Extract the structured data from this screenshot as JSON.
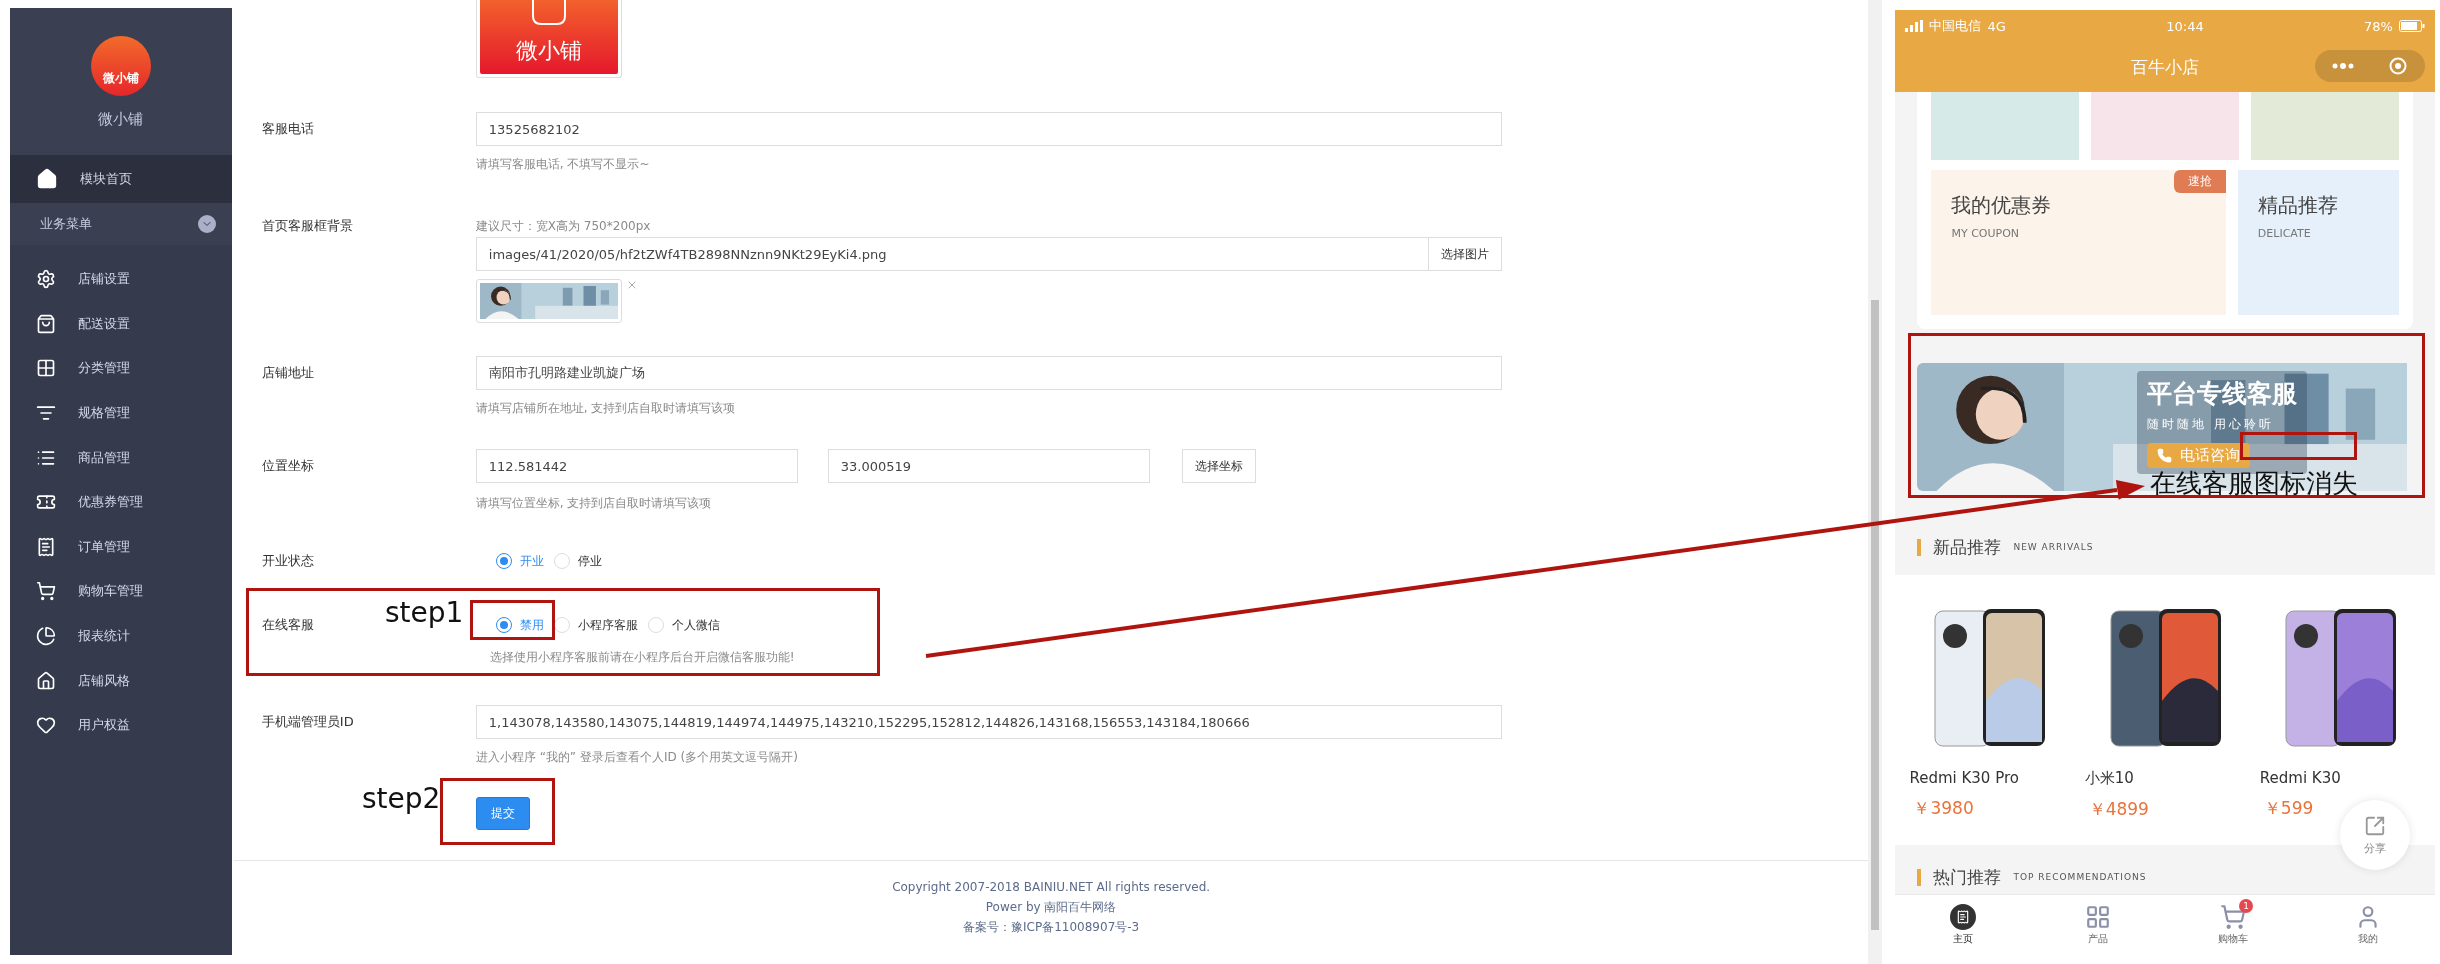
{
  "sidebar": {
    "logo_text": "微小铺",
    "brand": "微小铺",
    "home": {
      "label": "模块首页",
      "selected": true
    },
    "group": {
      "label": "业务菜单",
      "expanded": true
    },
    "items": [
      {
        "label": "店铺设置"
      },
      {
        "label": "配送设置"
      },
      {
        "label": "分类管理"
      },
      {
        "label": "规格管理"
      },
      {
        "label": "商品管理"
      },
      {
        "label": "优惠券管理"
      },
      {
        "label": "订单管理"
      },
      {
        "label": "购物车管理"
      },
      {
        "label": "报表统计"
      },
      {
        "label": "店铺风格"
      },
      {
        "label": "用户权益"
      }
    ]
  },
  "form": {
    "rows": [
      {
        "kind": "logo_image",
        "text": "微小铺"
      },
      {
        "kind": "input",
        "label": "客服电话",
        "value": "13525682102",
        "hint": "请填写客服电话, 不填写不显示~"
      },
      {
        "kind": "image_picker",
        "label": "首页客服框背景",
        "note": "建议尺寸：宽X高为 750*200px",
        "value": "images/41/2020/05/hf2tZWf4TB2898NNznn9NKt29EyKi4.png",
        "button": "选择图片"
      },
      {
        "kind": "input",
        "label": "店铺地址",
        "value": "南阳市孔明路建业凯旋广场",
        "hint": "请填写店铺所在地址, 支持到店自取时请填写该项"
      },
      {
        "kind": "coords",
        "label": "位置坐标",
        "values": [
          "112.581442",
          "33.000519"
        ],
        "button": "选择坐标",
        "hint": "请填写位置坐标, 支持到店自取时请填写该项"
      },
      {
        "kind": "radio",
        "label": "开业状态",
        "options": [
          {
            "label": "开业",
            "selected": true
          },
          {
            "label": "停业",
            "selected": false
          }
        ]
      },
      {
        "kind": "radio",
        "label": "在线客服",
        "options": [
          {
            "label": "禁用",
            "selected": true
          },
          {
            "label": "小程序客服",
            "selected": false
          },
          {
            "label": "个人微信",
            "selected": false
          }
        ],
        "hint": "选择使用小程序客服前请在小程序后台开启微信客服功能!"
      },
      {
        "kind": "input",
        "label": "手机端管理员ID",
        "value": "1,143078,143580,143075,144819,144974,144975,143210,152295,152812,144826,143168,156553,143184,180666",
        "hint": "进入小程序 “我的” 登录后查看个人ID (多个用英文逗号隔开)"
      }
    ],
    "submit": "提交"
  },
  "footer": [
    "Copyright 2007-2018 BAINIU.NET All rights reserved.",
    "Power by 南阳百牛网络",
    "备案号：豫ICP备11008907号-3"
  ],
  "annotations": [
    {
      "text": "step1"
    },
    {
      "text": "step2"
    },
    {
      "text": "在线客服图标消失"
    }
  ],
  "phone": {
    "status": {
      "carrier": "中国电信",
      "network": "4G",
      "time": "10:44",
      "battery": "78%"
    },
    "title": "百牛小店",
    "coupon": {
      "title": "我的优惠券",
      "subtitle": "MY COUPON",
      "badge": "速抢"
    },
    "featured": {
      "title": "精品推荐",
      "subtitle": "DELICATE"
    },
    "banner": {
      "title": "平台专线客服",
      "subtitle": "随时随地 用心聆听",
      "button": "电话咨询"
    },
    "new_arrivals": {
      "title": "新品推荐",
      "subtitle": "NEW ARRIVALS",
      "products": [
        {
          "name": "Redmi K30 Pro",
          "price": "￥3980"
        },
        {
          "name": "小米10",
          "price": "￥4899"
        },
        {
          "name": "Redmi K30",
          "price": "￥599"
        }
      ]
    },
    "share": "分享",
    "hot": {
      "title": "热门推荐",
      "subtitle": "TOP RECOMMENDATIONS"
    },
    "tabs": [
      {
        "label": "主页",
        "selected": true
      },
      {
        "label": "产品",
        "selected": false
      },
      {
        "label": "购物车",
        "selected": false,
        "badge": "1"
      },
      {
        "label": "我的",
        "selected": false
      }
    ]
  }
}
